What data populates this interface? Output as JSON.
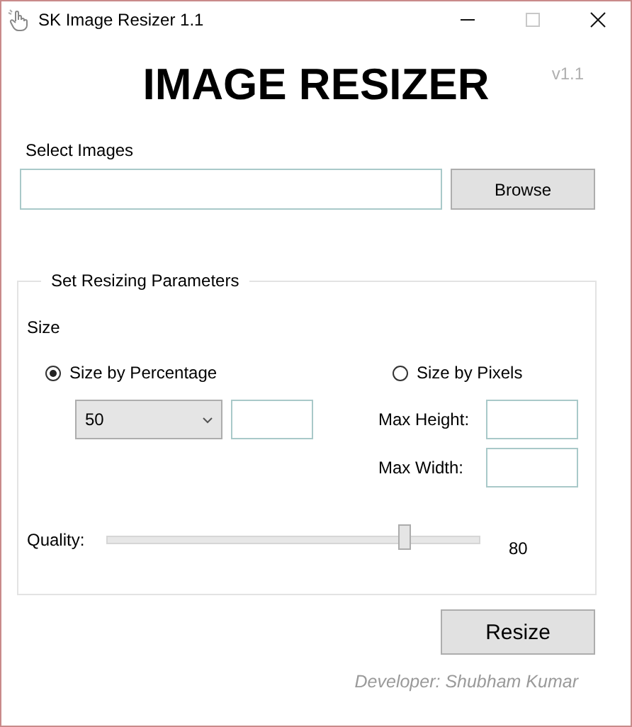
{
  "window": {
    "title": "SK Image Resizer 1.1",
    "controls": [
      {
        "kind": "minimize",
        "disabled": false
      },
      {
        "kind": "maximize",
        "disabled": true
      },
      {
        "kind": "close",
        "disabled": false
      }
    ]
  },
  "heading": "IMAGE RESIZER",
  "version": "v1.1",
  "select_images": {
    "label": "Select Images",
    "button": "Browse"
  },
  "parameters": {
    "title": "Set Resizing Parameters",
    "size_label": "Size",
    "options": [
      {
        "label": "Size by Percentage",
        "selected": true
      },
      {
        "label": "Size by Pixels",
        "selected": false
      }
    ],
    "percentage": {
      "value": "50"
    },
    "fields": [
      {
        "label": "Max Height:"
      },
      {
        "label": "Max Width:"
      }
    ],
    "quality": {
      "label": "Quality:",
      "level": 0.8,
      "reading": "80"
    }
  },
  "resize_button": "Resize",
  "credit": "Developer: Shubham Kumar"
}
